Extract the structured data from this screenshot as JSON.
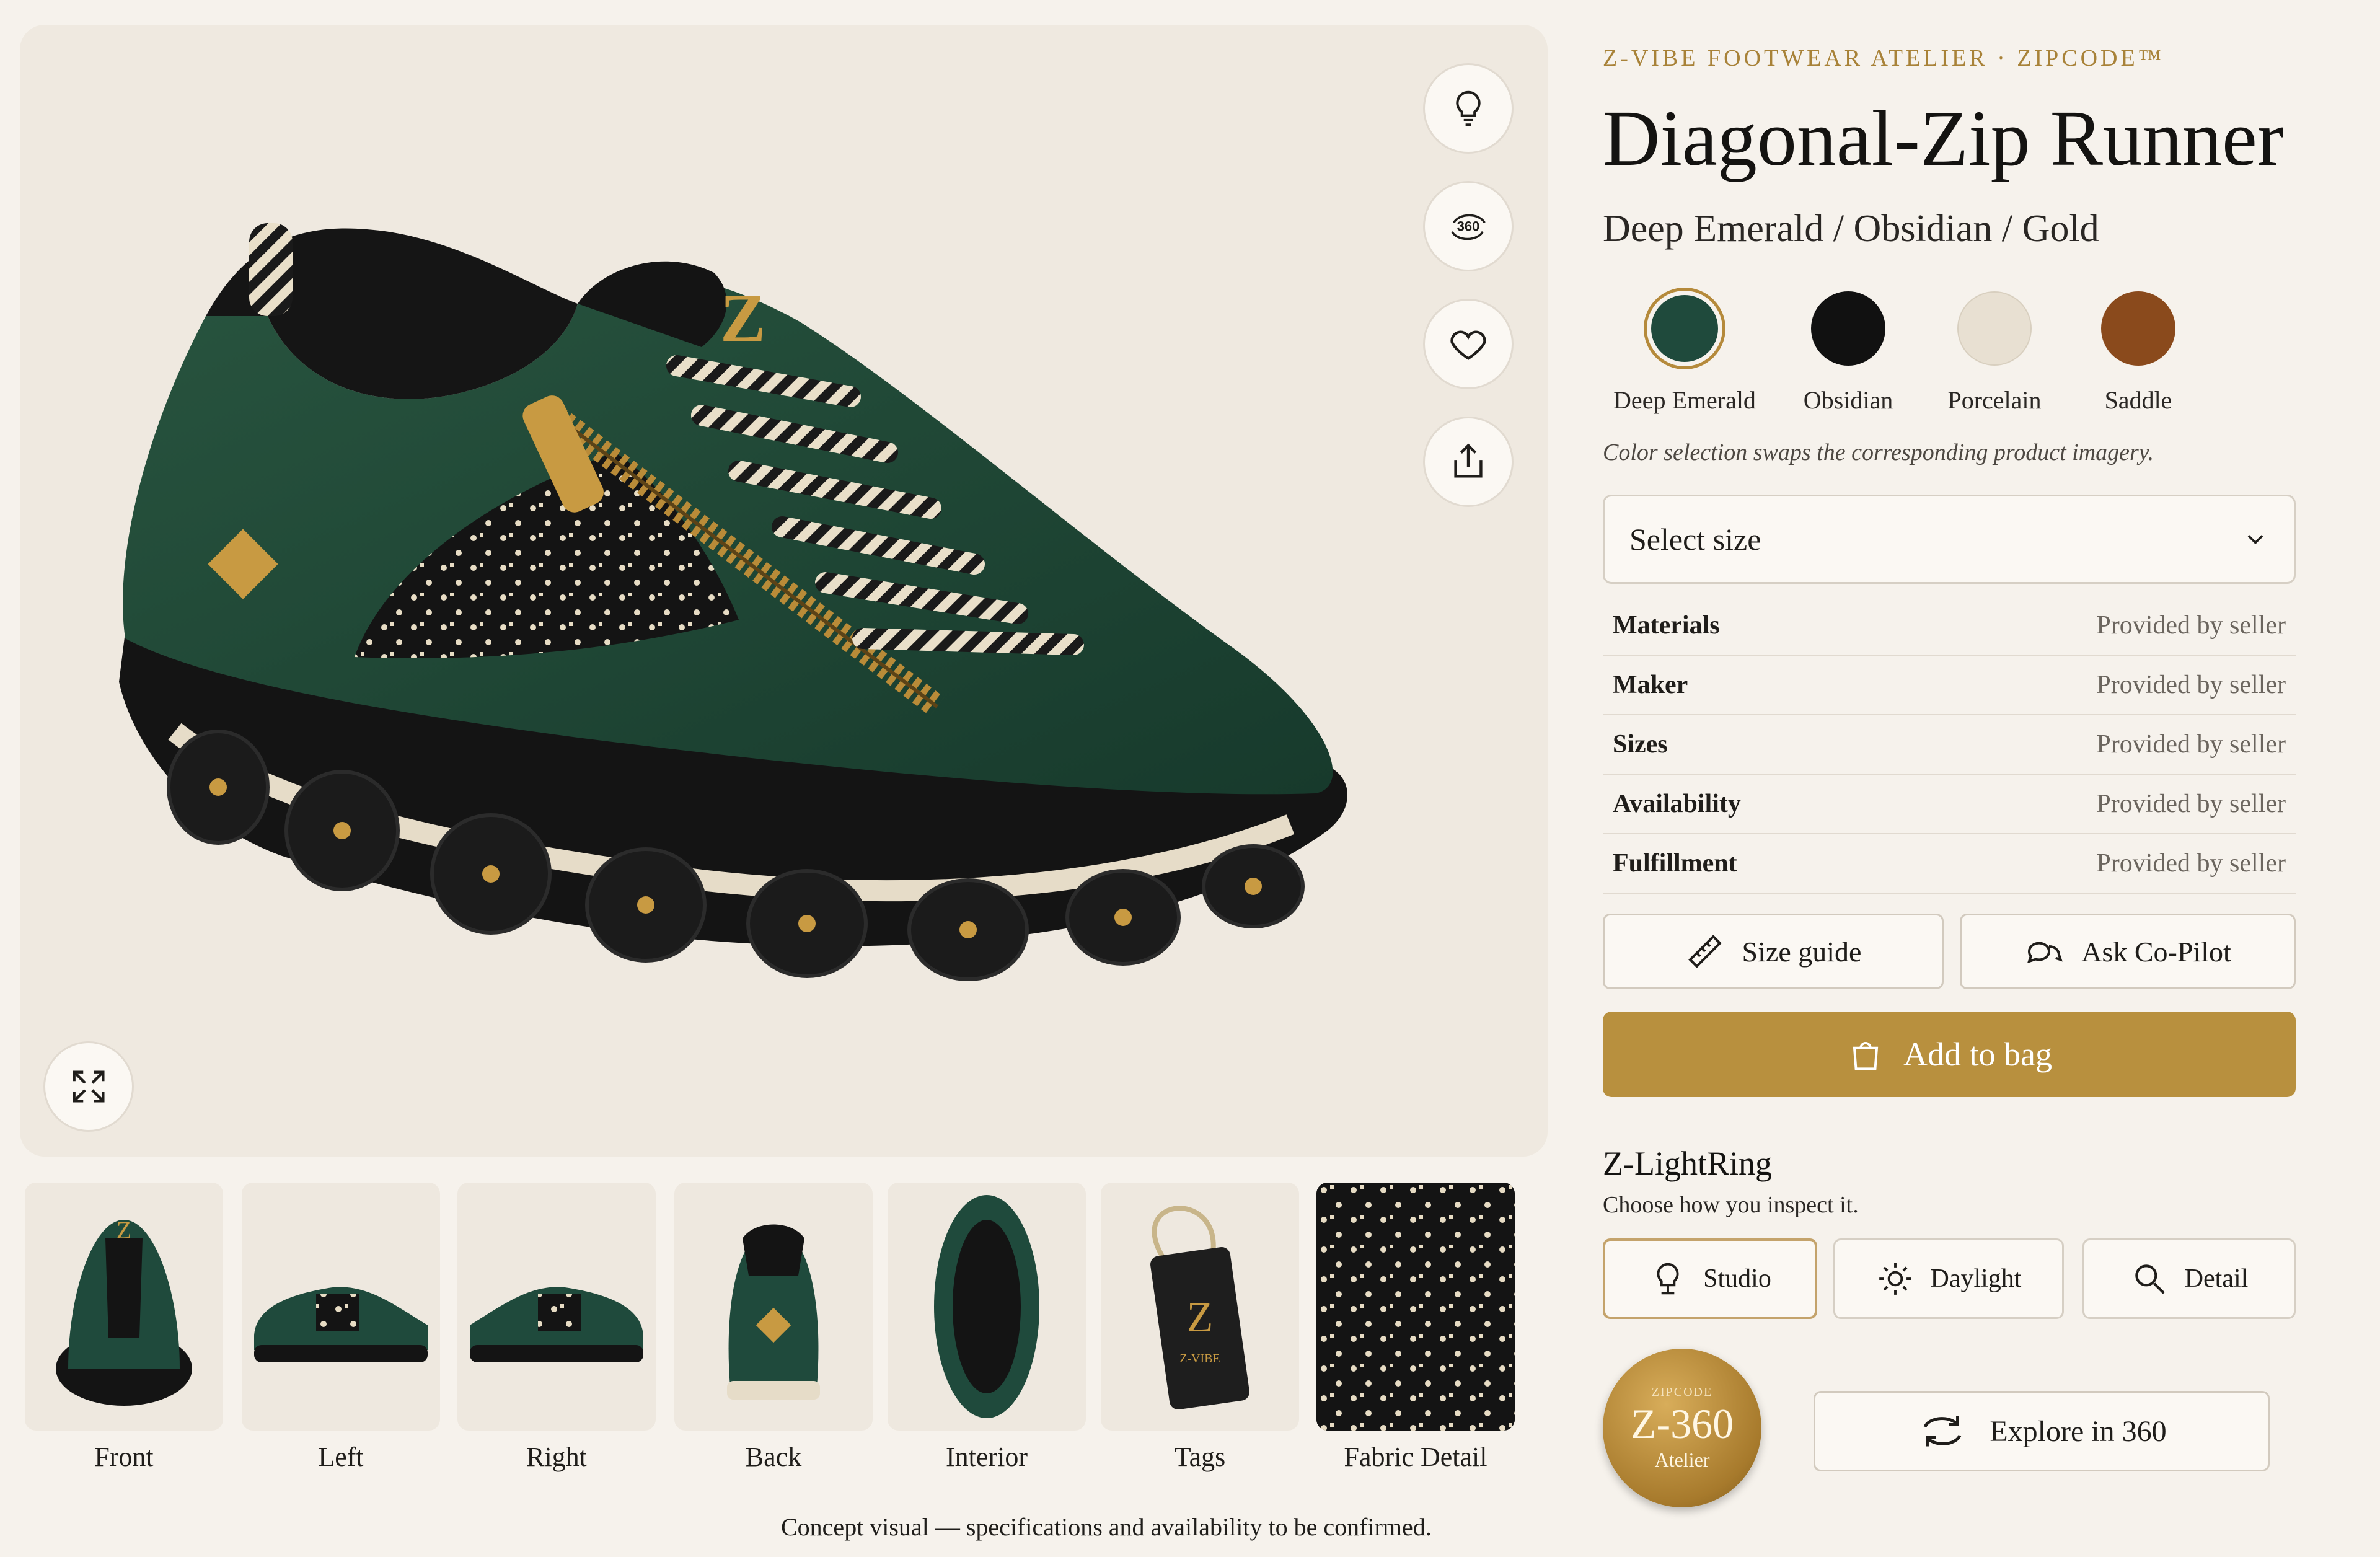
{
  "brand": "Z-VIBE FOOTWEAR ATELIER · ZIPCODE™",
  "title": "Diagonal-Zip Runner",
  "subtitle": "Deep Emerald / Obsidian / Gold",
  "colors": [
    {
      "name": "Deep Emerald",
      "hex": "#1f4a3c",
      "selected": true
    },
    {
      "name": "Obsidian",
      "hex": "#111111",
      "selected": false
    },
    {
      "name": "Porcelain",
      "hex": "#e8e0d2",
      "selected": false
    },
    {
      "name": "Saddle",
      "hex": "#8a4a1c",
      "selected": false
    }
  ],
  "color_note": "Color selection swaps the corresponding product imagery.",
  "size_select": {
    "placeholder": "Select size"
  },
  "specs": [
    {
      "key": "Materials",
      "value": "Provided by seller"
    },
    {
      "key": "Maker",
      "value": "Provided by seller"
    },
    {
      "key": "Sizes",
      "value": "Provided by seller"
    },
    {
      "key": "Availability",
      "value": "Provided by seller"
    },
    {
      "key": "Fulfillment",
      "value": "Provided by seller"
    }
  ],
  "buttons": {
    "size_guide": "Size guide",
    "ask": "Ask Co-Pilot",
    "add": "Add to bag",
    "explore": "Explore in 360"
  },
  "hero_actions": {
    "view360": "360",
    "shoe_letter": "Z"
  },
  "thumbnails": [
    "Front",
    "Left",
    "Right",
    "Back",
    "Interior",
    "Tags",
    "Fabric Detail"
  ],
  "tag_text": "Z-VIBE",
  "lightring": {
    "title": "Z-LightRing",
    "subtitle": "Choose how you inspect it.",
    "modes": [
      "Studio",
      "Daylight",
      "Detail"
    ],
    "active": "Studio"
  },
  "medal": {
    "top": "ZIPCODE",
    "main": "Z-360",
    "sub": "Atelier"
  },
  "footnote": "Concept visual — specifications and availability to be confirmed.",
  "accent": "#b8903e"
}
